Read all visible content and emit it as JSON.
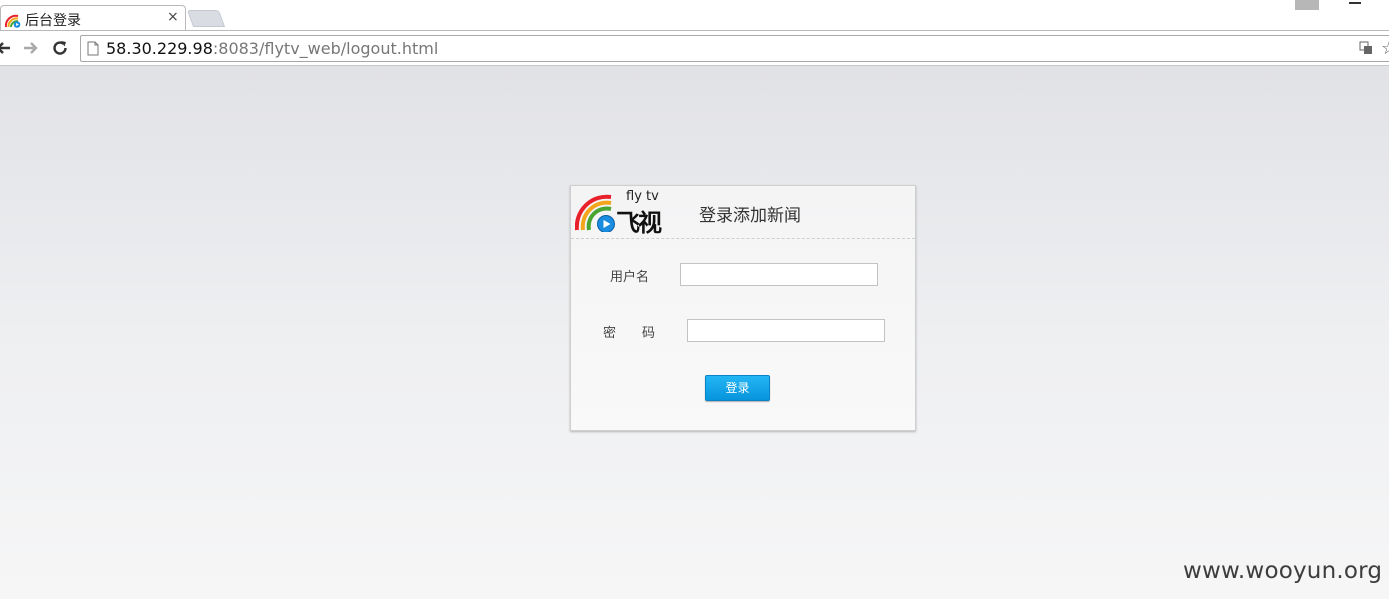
{
  "browser": {
    "tab_title": "后台登录",
    "tab_close": "×",
    "url_host": "58.30.229.98",
    "url_rest": ":8083/flytv_web/logout.html",
    "star": "☆"
  },
  "login": {
    "logo_caption": "fly tv",
    "logo_name": "飞视",
    "title": "登录添加新闻",
    "username_label": "用户名",
    "username_value": "",
    "password_label": "密　　码",
    "password_value": "",
    "submit_label": "登录"
  },
  "colors": {
    "button": "#0794dc",
    "page_top": "#e1e2e6",
    "page_bottom": "#f6f6f7"
  },
  "watermark": "www.wooyun.org"
}
